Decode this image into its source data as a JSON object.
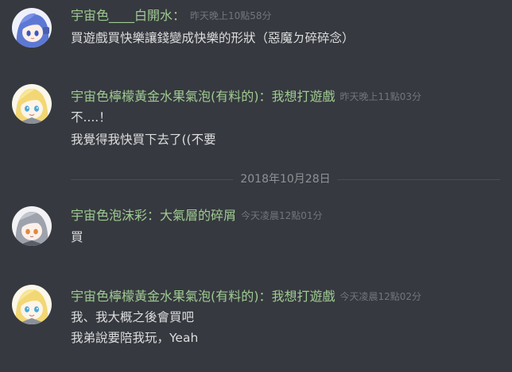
{
  "messages": [
    {
      "author": "宇宙色____白開水：",
      "timestamp": "昨天晚上10點58分",
      "avatar": "blue-hair-avatar",
      "lines": [
        "買遊戲買快樂讓錢變成快樂的形狀（惡魔ㄉ碎碎念）"
      ]
    },
    {
      "author": "宇宙色檸檬黃金水果氣泡(有料的)：我想打遊戲",
      "timestamp": "昨天晚上11點03分",
      "avatar": "blonde-hair-avatar",
      "lines": [
        "不....！",
        "我覺得我快買下去了((不要"
      ]
    },
    {
      "author": "宇宙色泡沫彩：大氣層的碎屑",
      "timestamp": "今天凌晨12點01分",
      "avatar": "gray-hair-avatar",
      "lines": [
        "買"
      ]
    },
    {
      "author": "宇宙色檸檬黃金水果氣泡(有料的)：我想打遊戲",
      "timestamp": "今天凌晨12點02分",
      "avatar": "blonde-hair-avatar",
      "lines": [
        "我、我大概之後會買吧",
        "我弟說要陪我玩，Yeah"
      ]
    }
  ],
  "date_divider": "2018年10月28日",
  "colors": {
    "background": "#36393f",
    "username": "#9fcb92",
    "message_text": "#dcddde",
    "timestamp": "#72767d",
    "divider": "#4a4d53"
  }
}
